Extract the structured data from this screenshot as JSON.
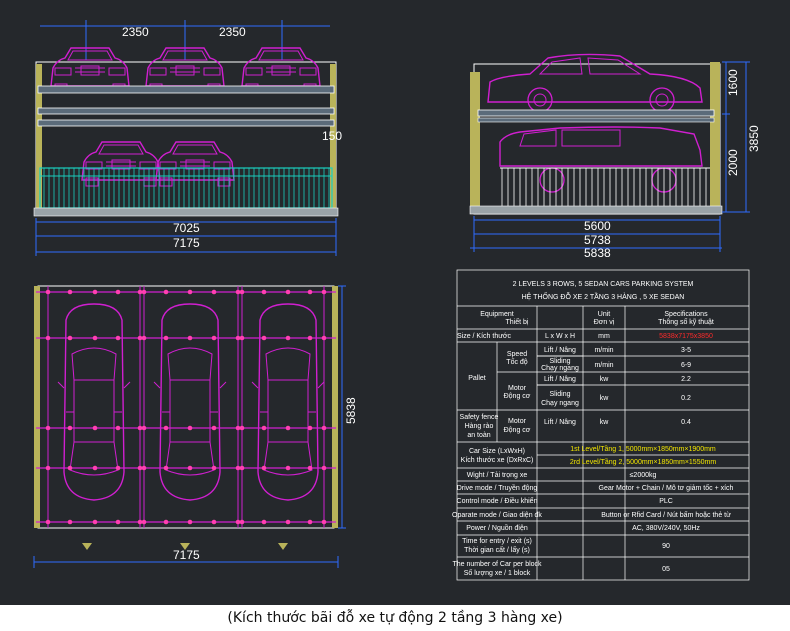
{
  "caption": "(Kích thước bãi đỗ xe tự động 2 tầng 3 hàng xe)",
  "colors": {
    "background": "#25282c",
    "frame": "#ffffff",
    "car": "#d01fd0",
    "fence": "#19d0c0",
    "dimension": "#2f6bff",
    "highlight_yellow": "#f2e600",
    "highlight_red": "#ff2a2a",
    "marker": "#b9b35a"
  },
  "front_view": {
    "dim_left": "2350",
    "dim_right": "2350",
    "dim_mid": "150",
    "dim_inner": "7025",
    "dim_outer": "7175"
  },
  "side_view": {
    "dim_upper": "1600",
    "dim_total": "3850",
    "dim_lower": "2000",
    "dim_a": "5600",
    "dim_b": "5738",
    "dim_c": "5838"
  },
  "plan_view": {
    "dim_depth": "5838",
    "dim_width": "7175"
  },
  "table": {
    "title_en": "2 LEVELS 3 ROWS, 5 SEDAN CARS PARKING SYSTEM",
    "title_vi": "HỆ THỐNG ĐỖ XE 2 TẦNG 3 HÀNG , 5 XE SEDAN",
    "head": {
      "equipment": "Equipment",
      "equipment_vi": "Thiết bị",
      "unit": "Unit",
      "unit_vi": "Đơn vị",
      "spec": "Specifications",
      "spec_vi": "Thông số kỹ thuật"
    },
    "size_label": "Size / Kích thước",
    "size_dims": "L x W x H",
    "size_unit": "mm",
    "size_value": "5838x7175x3850",
    "pallet": "Pallet",
    "speed": "Speed",
    "speed_vi": "Tốc độ",
    "motor": "Motor",
    "motor_vi": "Động cơ",
    "lift": "Lift / Nâng",
    "sliding": "Sliding",
    "sliding_vi": "Chạy ngang",
    "speed_unit": "m/min",
    "lift_speed": "3-5",
    "slide_speed": "6-9",
    "kw": "kw",
    "lift_power": "2.2",
    "slide_power": "0.2",
    "fence": "Safety fence",
    "fence_vi": "Hàng rào",
    "fence_vi2": "an toàn",
    "fence_lift": "Lift / Nâng",
    "fence_power": "0.4",
    "carsize": "Car Size (LxWxH)",
    "carsize_vi": "Kích thước xe (DxRxC)",
    "level1": "1st Level/Tầng 1, 5000mm×1850mm×1900mm",
    "level2": "2rd Level/Tầng 2, 5000mm×1850mm×1550mm",
    "weight": "Wight / Tải trọng xe",
    "weight_val": "≤2000kg",
    "drive": "Drive mode / Truyền động",
    "drive_val": "Gear Motor + Chain / Mô tơ giảm tốc + xích",
    "control": "Control mode / Điều khiển",
    "control_val": "PLC",
    "operate": "Oparate mode / Giao diện đk",
    "operate_val": "Button or Rfid Card / Nút bấm hoặc thẻ từ",
    "power": "Power / Nguồn điện",
    "power_val": "AC, 380V/240V, 50Hz",
    "time": "Time for entry / exit (s)",
    "time_vi": "Thời gian cất / lấy (s)",
    "time_val": "90",
    "number": "The number of Car per block",
    "number_vi": "Số lượng xe / 1 block",
    "number_val": "05"
  }
}
